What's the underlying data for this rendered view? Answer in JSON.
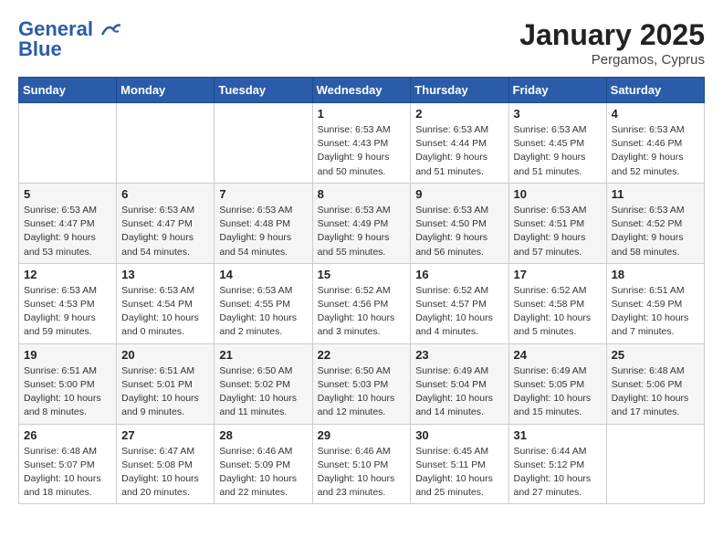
{
  "header": {
    "logo_line1": "General",
    "logo_line2": "Blue",
    "month_title": "January 2025",
    "subtitle": "Pergamos, Cyprus"
  },
  "weekdays": [
    "Sunday",
    "Monday",
    "Tuesday",
    "Wednesday",
    "Thursday",
    "Friday",
    "Saturday"
  ],
  "weeks": [
    [
      {
        "day": "",
        "info": ""
      },
      {
        "day": "",
        "info": ""
      },
      {
        "day": "",
        "info": ""
      },
      {
        "day": "1",
        "info": "Sunrise: 6:53 AM\nSunset: 4:43 PM\nDaylight: 9 hours\nand 50 minutes."
      },
      {
        "day": "2",
        "info": "Sunrise: 6:53 AM\nSunset: 4:44 PM\nDaylight: 9 hours\nand 51 minutes."
      },
      {
        "day": "3",
        "info": "Sunrise: 6:53 AM\nSunset: 4:45 PM\nDaylight: 9 hours\nand 51 minutes."
      },
      {
        "day": "4",
        "info": "Sunrise: 6:53 AM\nSunset: 4:46 PM\nDaylight: 9 hours\nand 52 minutes."
      }
    ],
    [
      {
        "day": "5",
        "info": "Sunrise: 6:53 AM\nSunset: 4:47 PM\nDaylight: 9 hours\nand 53 minutes."
      },
      {
        "day": "6",
        "info": "Sunrise: 6:53 AM\nSunset: 4:47 PM\nDaylight: 9 hours\nand 54 minutes."
      },
      {
        "day": "7",
        "info": "Sunrise: 6:53 AM\nSunset: 4:48 PM\nDaylight: 9 hours\nand 54 minutes."
      },
      {
        "day": "8",
        "info": "Sunrise: 6:53 AM\nSunset: 4:49 PM\nDaylight: 9 hours\nand 55 minutes."
      },
      {
        "day": "9",
        "info": "Sunrise: 6:53 AM\nSunset: 4:50 PM\nDaylight: 9 hours\nand 56 minutes."
      },
      {
        "day": "10",
        "info": "Sunrise: 6:53 AM\nSunset: 4:51 PM\nDaylight: 9 hours\nand 57 minutes."
      },
      {
        "day": "11",
        "info": "Sunrise: 6:53 AM\nSunset: 4:52 PM\nDaylight: 9 hours\nand 58 minutes."
      }
    ],
    [
      {
        "day": "12",
        "info": "Sunrise: 6:53 AM\nSunset: 4:53 PM\nDaylight: 9 hours\nand 59 minutes."
      },
      {
        "day": "13",
        "info": "Sunrise: 6:53 AM\nSunset: 4:54 PM\nDaylight: 10 hours\nand 0 minutes."
      },
      {
        "day": "14",
        "info": "Sunrise: 6:53 AM\nSunset: 4:55 PM\nDaylight: 10 hours\nand 2 minutes."
      },
      {
        "day": "15",
        "info": "Sunrise: 6:52 AM\nSunset: 4:56 PM\nDaylight: 10 hours\nand 3 minutes."
      },
      {
        "day": "16",
        "info": "Sunrise: 6:52 AM\nSunset: 4:57 PM\nDaylight: 10 hours\nand 4 minutes."
      },
      {
        "day": "17",
        "info": "Sunrise: 6:52 AM\nSunset: 4:58 PM\nDaylight: 10 hours\nand 5 minutes."
      },
      {
        "day": "18",
        "info": "Sunrise: 6:51 AM\nSunset: 4:59 PM\nDaylight: 10 hours\nand 7 minutes."
      }
    ],
    [
      {
        "day": "19",
        "info": "Sunrise: 6:51 AM\nSunset: 5:00 PM\nDaylight: 10 hours\nand 8 minutes."
      },
      {
        "day": "20",
        "info": "Sunrise: 6:51 AM\nSunset: 5:01 PM\nDaylight: 10 hours\nand 9 minutes."
      },
      {
        "day": "21",
        "info": "Sunrise: 6:50 AM\nSunset: 5:02 PM\nDaylight: 10 hours\nand 11 minutes."
      },
      {
        "day": "22",
        "info": "Sunrise: 6:50 AM\nSunset: 5:03 PM\nDaylight: 10 hours\nand 12 minutes."
      },
      {
        "day": "23",
        "info": "Sunrise: 6:49 AM\nSunset: 5:04 PM\nDaylight: 10 hours\nand 14 minutes."
      },
      {
        "day": "24",
        "info": "Sunrise: 6:49 AM\nSunset: 5:05 PM\nDaylight: 10 hours\nand 15 minutes."
      },
      {
        "day": "25",
        "info": "Sunrise: 6:48 AM\nSunset: 5:06 PM\nDaylight: 10 hours\nand 17 minutes."
      }
    ],
    [
      {
        "day": "26",
        "info": "Sunrise: 6:48 AM\nSunset: 5:07 PM\nDaylight: 10 hours\nand 18 minutes."
      },
      {
        "day": "27",
        "info": "Sunrise: 6:47 AM\nSunset: 5:08 PM\nDaylight: 10 hours\nand 20 minutes."
      },
      {
        "day": "28",
        "info": "Sunrise: 6:46 AM\nSunset: 5:09 PM\nDaylight: 10 hours\nand 22 minutes."
      },
      {
        "day": "29",
        "info": "Sunrise: 6:46 AM\nSunset: 5:10 PM\nDaylight: 10 hours\nand 23 minutes."
      },
      {
        "day": "30",
        "info": "Sunrise: 6:45 AM\nSunset: 5:11 PM\nDaylight: 10 hours\nand 25 minutes."
      },
      {
        "day": "31",
        "info": "Sunrise: 6:44 AM\nSunset: 5:12 PM\nDaylight: 10 hours\nand 27 minutes."
      },
      {
        "day": "",
        "info": ""
      }
    ]
  ]
}
